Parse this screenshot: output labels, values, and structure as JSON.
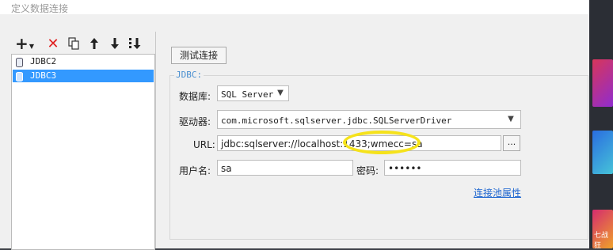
{
  "window": {
    "title": "定义数据连接"
  },
  "toolbar": {
    "add_icon": "plus-icon",
    "delete_icon": "delete-x-icon",
    "copy_icon": "copy-icon",
    "up_icon": "arrow-up-icon",
    "down_icon": "arrow-down-icon",
    "sort_icon": "sort-icon"
  },
  "connections": [
    {
      "name": "JDBC2",
      "selected": false
    },
    {
      "name": "JDBC3",
      "selected": true
    }
  ],
  "test_button": "测试连接",
  "group_label": "JDBC:",
  "database": {
    "label": "数据库:",
    "value": "SQL Server"
  },
  "driver": {
    "label": "驱动器:",
    "value": "com.microsoft.sqlserver.jdbc.SQLServerDriver"
  },
  "url": {
    "label": "URL:",
    "value": "jdbc:sqlserver://localhost:1433;wmecc=sa",
    "browse": "..."
  },
  "username": {
    "label": "用户名:",
    "value": "sa"
  },
  "password": {
    "label": "密码:",
    "value": "••••••"
  },
  "pool_link": "连接池属性",
  "background": {
    "tile_text": "七战狂"
  },
  "colors": {
    "selection": "#3399ff",
    "link": "#1e66d0",
    "highlight": "#f5e21b",
    "delete": "#e02020"
  }
}
